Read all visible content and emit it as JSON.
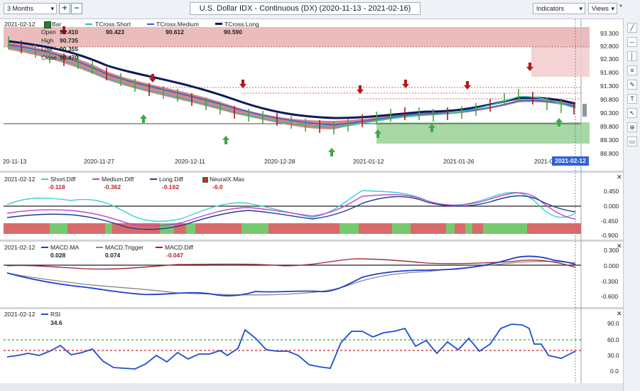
{
  "toolbar": {
    "timeframe": "3 Months",
    "plus": "+",
    "minus": "−",
    "title": "U.S. Dollar IDX - Continuous (DX) (2020-11-13 - 2021-02-16)",
    "indicators": "Indicators",
    "views": "Views",
    "star": "*"
  },
  "main": {
    "date": "2021-02-12",
    "bar_label": "Bar",
    "ohlc": [
      {
        "label": "Open",
        "value": "90.410"
      },
      {
        "label": "High",
        "value": "90.735"
      },
      {
        "label": "Low",
        "value": "90.355"
      },
      {
        "label": "Close",
        "value": "90.470"
      }
    ],
    "legend": [
      {
        "name": "TCross.Short",
        "value": "90.423",
        "color": "#2ec0a0"
      },
      {
        "name": "TCross.Medium",
        "value": "90.612",
        "color": "#2f62d6"
      },
      {
        "name": "TCross.Long",
        "value": "90.590",
        "color": "#0a1a55"
      }
    ],
    "y_ticks": [
      "93.300",
      "92.800",
      "92.300",
      "91.800",
      "91.300",
      "90.800",
      "90.300",
      "89.800",
      "89.300",
      "88.800"
    ],
    "x_ticks": [
      "20-11-13",
      "2020-11-27",
      "2020-12-11",
      "2020-12-28",
      "2021-01-12",
      "2021-01-26",
      "2021-0"
    ],
    "current_date": "2021-02-12"
  },
  "diff_panel": {
    "date": "2021-02-12",
    "legend": [
      {
        "name": "Short.Diff",
        "value": "-0.118",
        "color": "#3fd0d0"
      },
      {
        "name": "Medium.Diff",
        "value": "-0.362",
        "color": "#c040d0"
      },
      {
        "name": "Long.Diff",
        "value": "-0.162",
        "color": "#1e3f8f"
      },
      {
        "name": "NeuralX.Max",
        "value": "-6.0",
        "color": "#c03030"
      }
    ],
    "y_ticks": [
      "0.450",
      "0.000",
      "-0.450",
      "-0.900"
    ]
  },
  "macd_panel": {
    "date": "2021-02-12",
    "legend": [
      {
        "name": "MACD.MA",
        "value": "0.028",
        "color": "#1f3fd0"
      },
      {
        "name": "MACD.Trigger",
        "value": "0.074",
        "color": "#888888"
      },
      {
        "name": "MACD.Diff",
        "value": "-0.047",
        "color": "#a02030"
      }
    ],
    "y_ticks": [
      "0.300",
      "0.000",
      "-0.300",
      "-0.600"
    ]
  },
  "rsi_panel": {
    "date": "2021-02-12",
    "legend": [
      {
        "name": "RSI",
        "value": "34.6",
        "color": "#1f4fd0"
      }
    ],
    "y_ticks": [
      "90.0",
      "60.0",
      "30.0",
      "0.0"
    ]
  },
  "sidebar": {
    "icons": [
      "line-tool-icon",
      "hline-tool-icon",
      "vline-tool-icon",
      "fib-tool-icon",
      "pen-tool-icon",
      "text-tool-icon",
      "select-tool-icon",
      "zoom-tool-icon",
      "note-tool-icon"
    ]
  },
  "colors": {
    "up_arrow": "#3ea845",
    "down_arrow": "#b3171b",
    "resistance_zone": "#e8b0b0",
    "support_zone": "#9fd39c",
    "band_red": "#cf6f6f",
    "band_green": "#8fd08a"
  }
}
